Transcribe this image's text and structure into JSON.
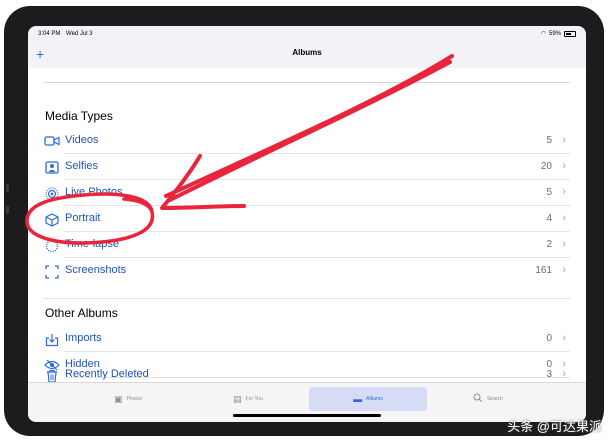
{
  "status_bar": {
    "time": "3:04 PM",
    "date": "Wed Jul 3",
    "battery": "59%"
  },
  "nav": {
    "add_icon": "plus-icon",
    "title": "Albums"
  },
  "media_types": {
    "title": "Media Types",
    "items": [
      {
        "label": "Videos",
        "count": "5",
        "icon": "video-camera-icon"
      },
      {
        "label": "Selfies",
        "count": "20",
        "icon": "person-square-icon"
      },
      {
        "label": "Live Photos",
        "count": "5",
        "icon": "live-photo-icon"
      },
      {
        "label": "Portrait",
        "count": "4",
        "icon": "cube-icon"
      },
      {
        "label": "Time-lapse",
        "count": "2",
        "icon": "timelapse-icon"
      },
      {
        "label": "Screenshots",
        "count": "161",
        "icon": "screenshot-icon"
      }
    ]
  },
  "other_albums": {
    "title": "Other Albums",
    "items": [
      {
        "label": "Imports",
        "count": "0",
        "icon": "import-icon"
      },
      {
        "label": "Hidden",
        "count": "0",
        "icon": "eye-slash-icon"
      },
      {
        "label": "Recently Deleted",
        "count": "3",
        "icon": "trash-icon"
      }
    ]
  },
  "tabs": [
    {
      "label": "Photos",
      "icon": "photos-icon",
      "active": false
    },
    {
      "label": "For You",
      "icon": "for-you-icon",
      "active": false
    },
    {
      "label": "Albums",
      "icon": "albums-icon",
      "active": true
    },
    {
      "label": "Search",
      "icon": "search-icon",
      "active": false
    }
  ],
  "watermark": "头条 @可达果派",
  "colors": {
    "accent": "#2f6bd8",
    "annotation": "#e8253a",
    "tab_active_bg": "#d7dcf6"
  }
}
